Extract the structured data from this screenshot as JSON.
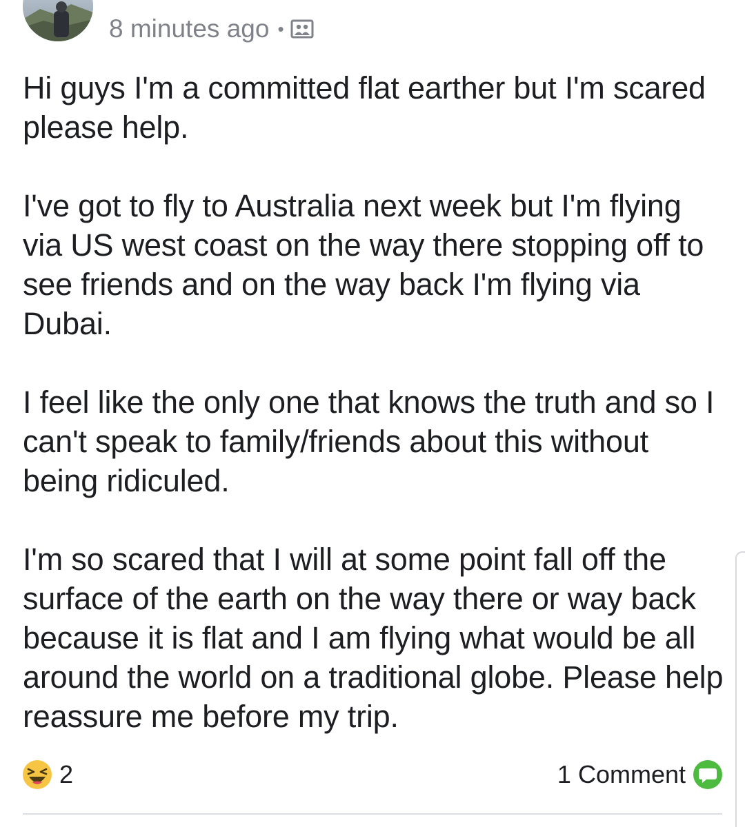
{
  "post": {
    "timestamp": "8 minutes ago",
    "separator": "•",
    "privacy_icon": "group-photo-icon",
    "paragraphs": [
      "Hi guys I'm a committed flat earther but I'm scared please help.",
      "I've got to fly to Australia next week but I'm flying via US west coast on the way there stopping off to see friends and on the way back I'm flying via Dubai.",
      "I feel like the only one that knows the truth and so I can't speak to family/friends about this without being ridiculed.",
      "I'm so scared that I will at some point fall off the surface of the earth on the way there or way back because it is flat and I am flying what would be all around the world on a traditional globe. Please help reassure me before my trip."
    ]
  },
  "footer": {
    "reaction_icon": "laughing-emoji-icon",
    "reaction_count": "2",
    "comment_label": "1 Comment",
    "comment_icon": "comment-bubble-icon"
  },
  "colors": {
    "meta_text": "#7f8288",
    "body_text": "#1c1e21",
    "comment_icon_green": "#4cbb3f",
    "emoji_yellow": "#f7c544",
    "divider": "#dadde1"
  }
}
